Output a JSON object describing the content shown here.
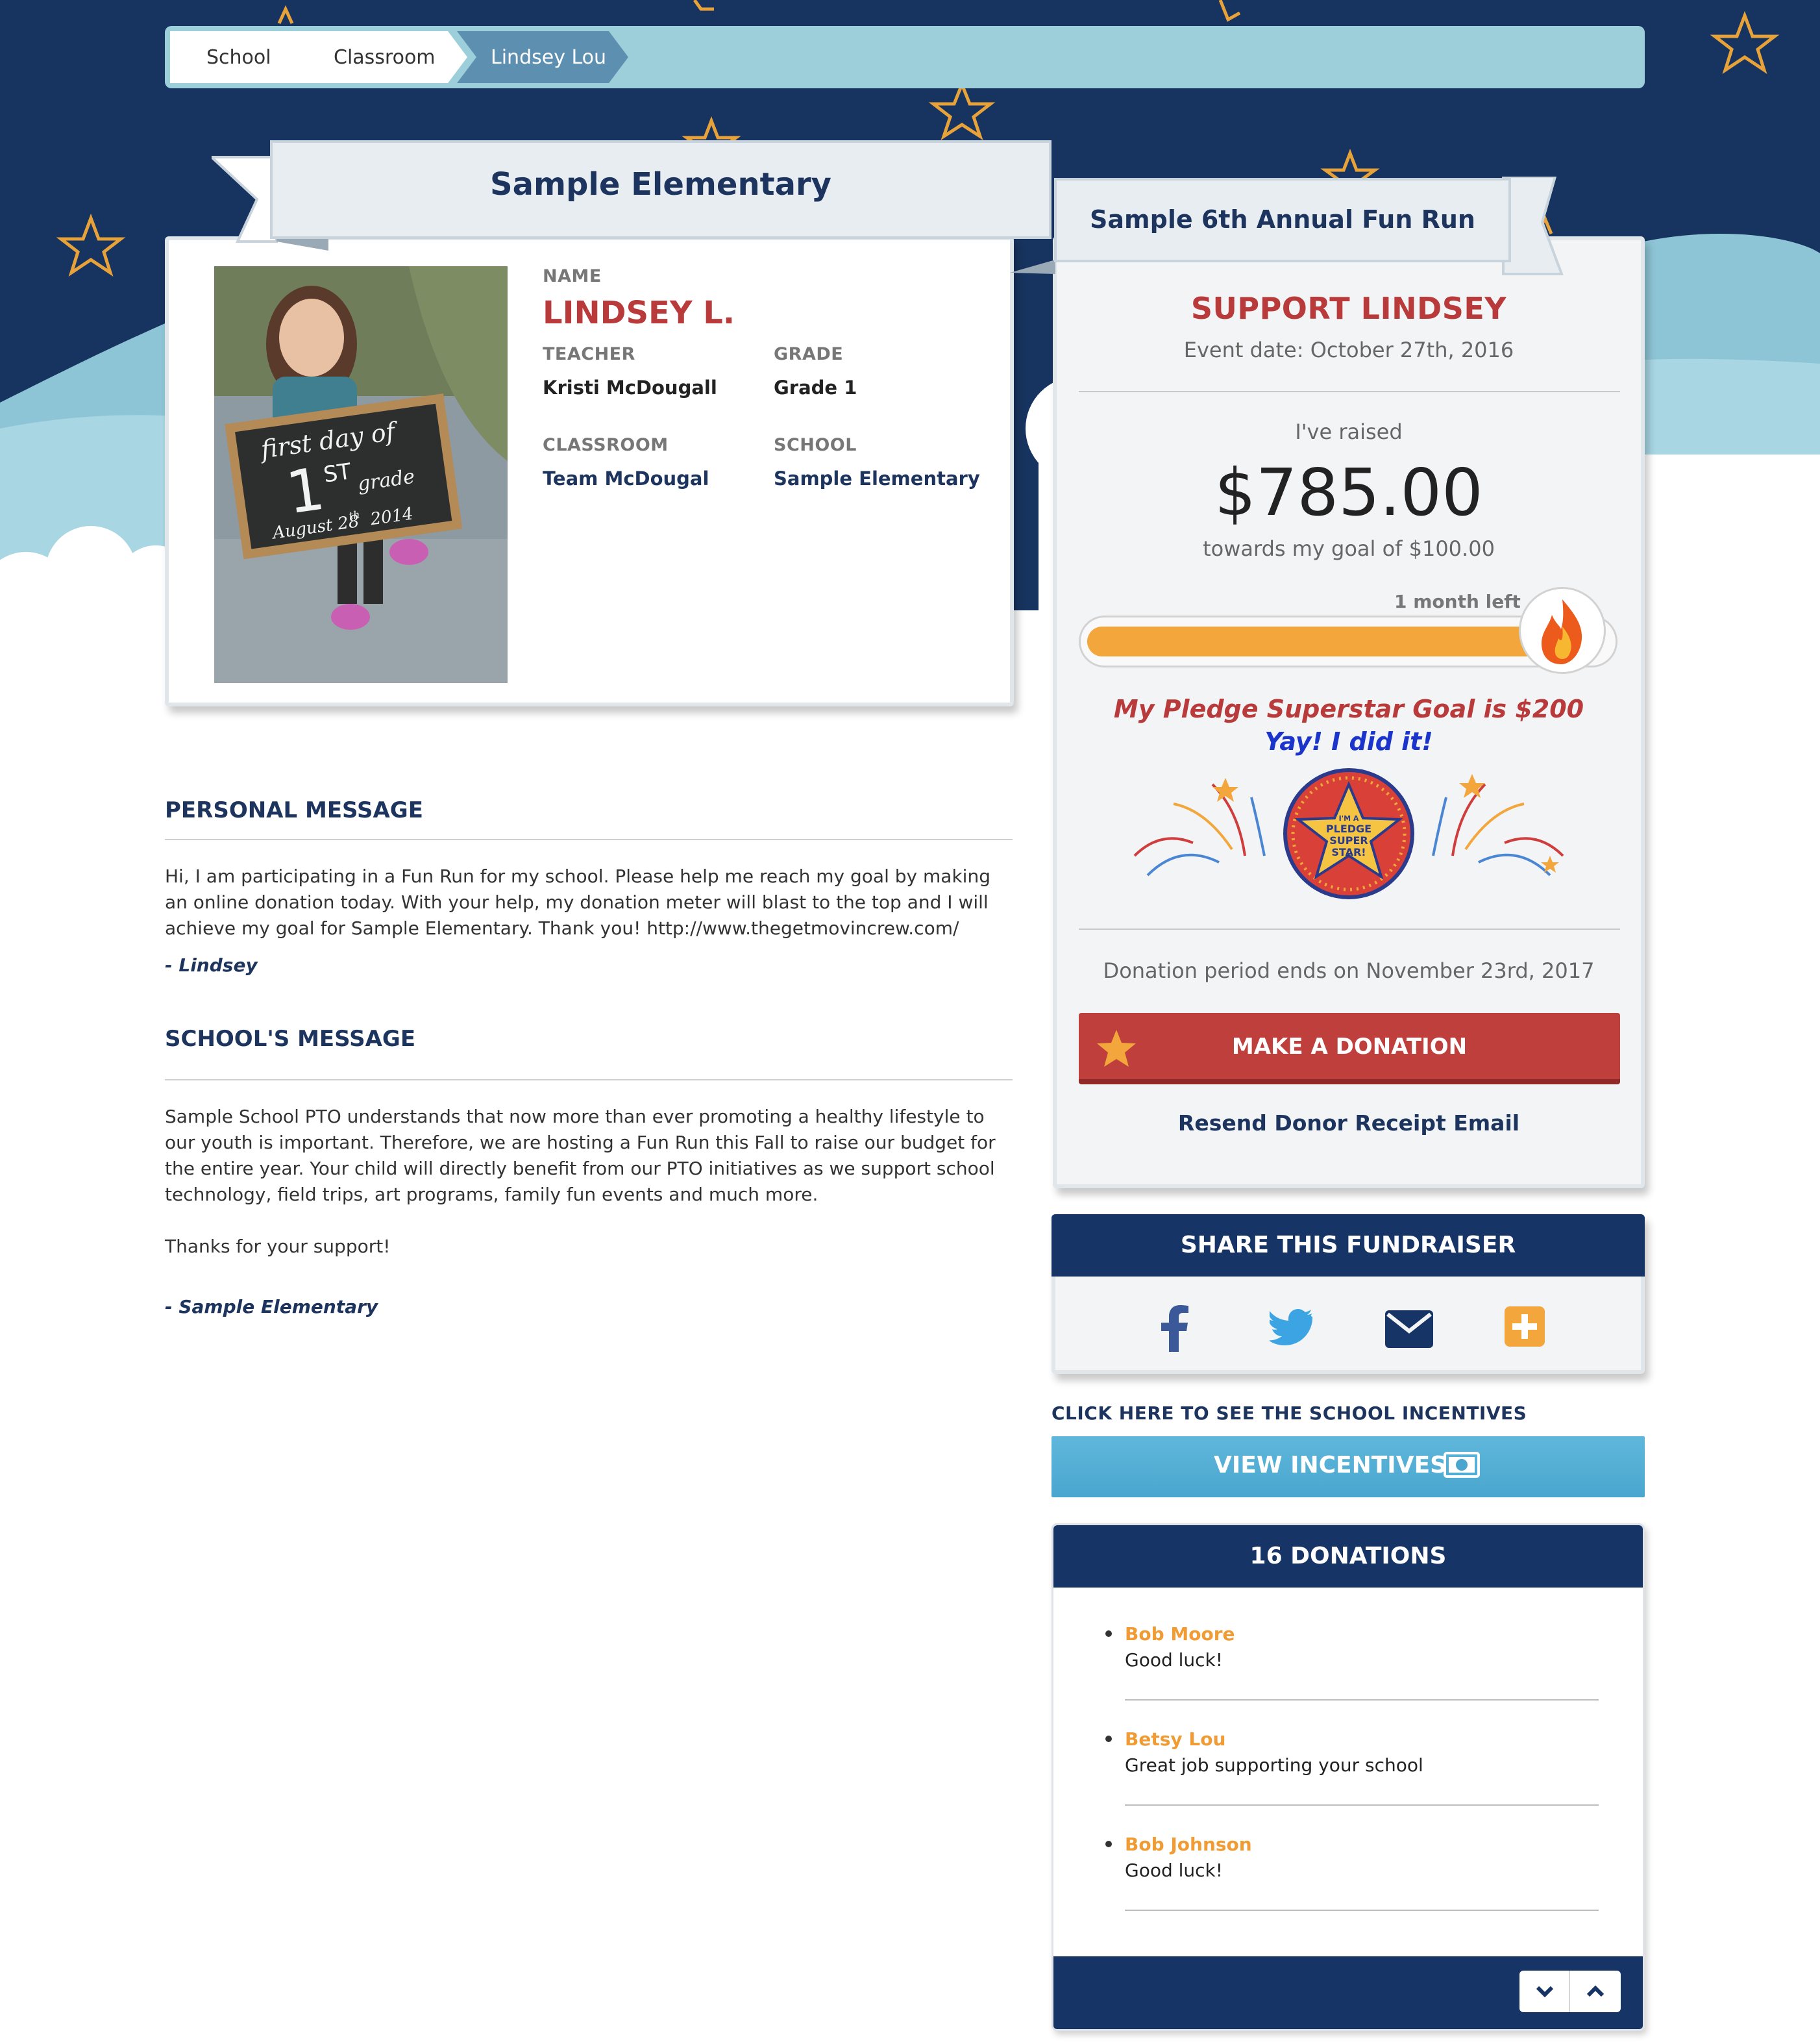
{
  "breadcrumb": [
    "School",
    "Classroom",
    "Lindsey Lou"
  ],
  "school_ribbon": "Sample Elementary",
  "event_ribbon": "Sample 6th Annual Fun Run",
  "profile": {
    "name_label": "NAME",
    "name": "LINDSEY L.",
    "teacher_label": "TEACHER",
    "teacher": "Kristi McDougall",
    "grade_label": "GRADE",
    "grade": "Grade 1",
    "classroom_label": "CLASSROOM",
    "classroom": "Team McDougal",
    "school_label": "SCHOOL",
    "school": "Sample Elementary",
    "photo_text": {
      "line1": "first day of",
      "big": "1",
      "sup": "ST",
      "word": "grade",
      "date": "August 28",
      "date_sup": "th",
      "year": "2014"
    }
  },
  "personal_message": {
    "title": "PERSONAL MESSAGE",
    "body": "Hi, I am participating in a Fun Run for my school. Please help me reach my goal by making an online donation today. With your help, my donation meter will blast to the top and I will achieve my goal for Sample Elementary. Thank you! http://www.thegetmovincrew.com/",
    "signature": "- Lindsey"
  },
  "school_message": {
    "title": "SCHOOL'S MESSAGE",
    "body": "Sample School PTO understands that now more than ever promoting a healthy lifestyle to our youth is important. Therefore, we are hosting a Fun Run this Fall to raise our budget for the entire year. Your child will directly benefit from our PTO initiatives as we support school technology, field trips, art programs, family fun events and much more.",
    "thanks": "Thanks for your support!",
    "signature": "- Sample Elementary"
  },
  "support": {
    "title": "SUPPORT LINDSEY",
    "event_date": "Event date: October 27th, 2016",
    "raised_label": "I've raised",
    "amount": "$785.00",
    "goal": "towards my goal of $100.00",
    "time_left": "1 month left",
    "progress": 1.0,
    "superstar_goal": "My Pledge Superstar Goal is $200",
    "yay": "Yay! I did it!",
    "badge": {
      "line1": "I'M A",
      "line2": "PLEDGE",
      "line3": "SUPER",
      "line4": "STAR!"
    },
    "period_end": "Donation period ends on November 23rd, 2017",
    "donate_button": "MAKE A DONATION",
    "resend": "Resend Donor Receipt Email"
  },
  "share": {
    "title": "SHARE THIS FUNDRAISER",
    "icons": [
      "facebook-icon",
      "twitter-icon",
      "email-icon",
      "add-more-icon"
    ]
  },
  "incentives": {
    "cta": "CLICK HERE TO SEE THE SCHOOL INCENTIVES",
    "button": "VIEW INCENTIVES"
  },
  "donations": {
    "title": "16 DONATIONS",
    "items": [
      {
        "name": "Bob Moore",
        "message": "Good luck!"
      },
      {
        "name": "Betsy Lou",
        "message": "Great job supporting your school"
      },
      {
        "name": "Bob Johnson",
        "message": "Good luck!"
      }
    ]
  },
  "colors": {
    "navy": "#173467",
    "sky": "#9ccfda",
    "red": "#bf3f3c",
    "orange": "#f2a63b",
    "star": "#e8a23a"
  }
}
